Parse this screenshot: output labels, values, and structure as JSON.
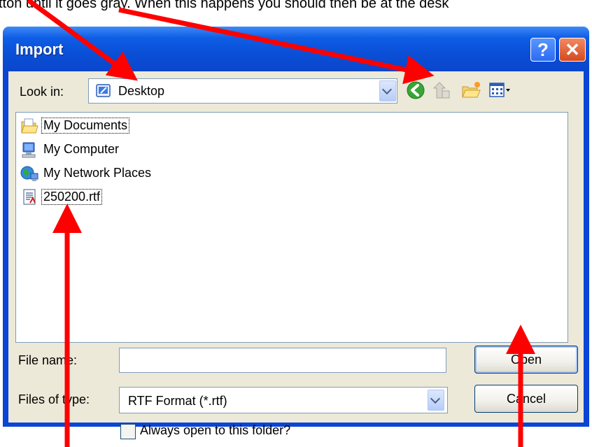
{
  "instruction": {
    "pre_text": "tton until it goes gray. When this happens you should then be at the desk",
    "note": ""
  },
  "dialog": {
    "title": "Import",
    "help_glyph": "?",
    "close_glyph": "✕"
  },
  "look_in": {
    "label": "Look in:",
    "value": "Desktop",
    "icon": "desktop-icon"
  },
  "toolbar": {
    "icons": [
      "back-icon",
      "up-folder-icon",
      "new-folder-icon",
      "views-menu-icon"
    ]
  },
  "files": [
    {
      "label": "My Documents",
      "icon": "my-documents-icon"
    },
    {
      "label": "My Computer",
      "icon": "my-computer-icon"
    },
    {
      "label": "My Network Places",
      "icon": "network-places-icon"
    },
    {
      "label": "250200.rtf",
      "icon": "rtf-file-icon"
    }
  ],
  "file_name": {
    "label": "File name:",
    "value": "",
    "placeholder": ""
  },
  "file_type": {
    "label": "Files of type:",
    "value": "RTF Format (*.rtf)"
  },
  "buttons": {
    "open": "Open",
    "cancel": "Cancel"
  },
  "always_open": {
    "label": "Always open to this folder?",
    "checked": false
  },
  "colors": {
    "titlebar": "#0a4fd7",
    "client": "#ece9d8",
    "annotation_arrow": "#ff0000"
  }
}
